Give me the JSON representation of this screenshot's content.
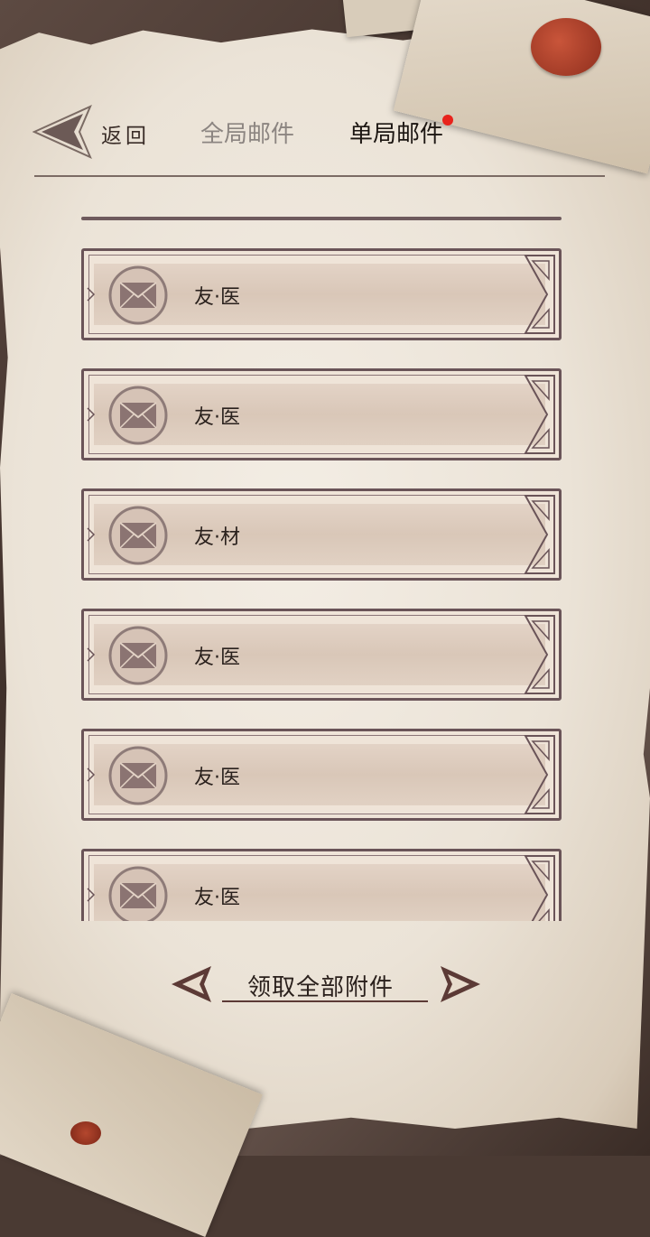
{
  "header": {
    "back_label": "返回",
    "tabs": [
      {
        "label": "全局邮件",
        "active": false
      },
      {
        "label": "单局邮件",
        "active": true,
        "has_notification": true
      }
    ]
  },
  "mails": [
    {
      "sender": "友·医",
      "icon": "envelope-icon"
    },
    {
      "sender": "友·医",
      "icon": "envelope-icon"
    },
    {
      "sender": "友·材",
      "icon": "envelope-icon"
    },
    {
      "sender": "友·医",
      "icon": "envelope-icon"
    },
    {
      "sender": "友·医",
      "icon": "envelope-icon"
    },
    {
      "sender": "友·医",
      "icon": "envelope-icon"
    }
  ],
  "footer": {
    "claim_all_label": "领取全部附件"
  },
  "colors": {
    "notification_dot": "#e8231c",
    "frame": "#6a5458",
    "seal": "#b4472e"
  }
}
